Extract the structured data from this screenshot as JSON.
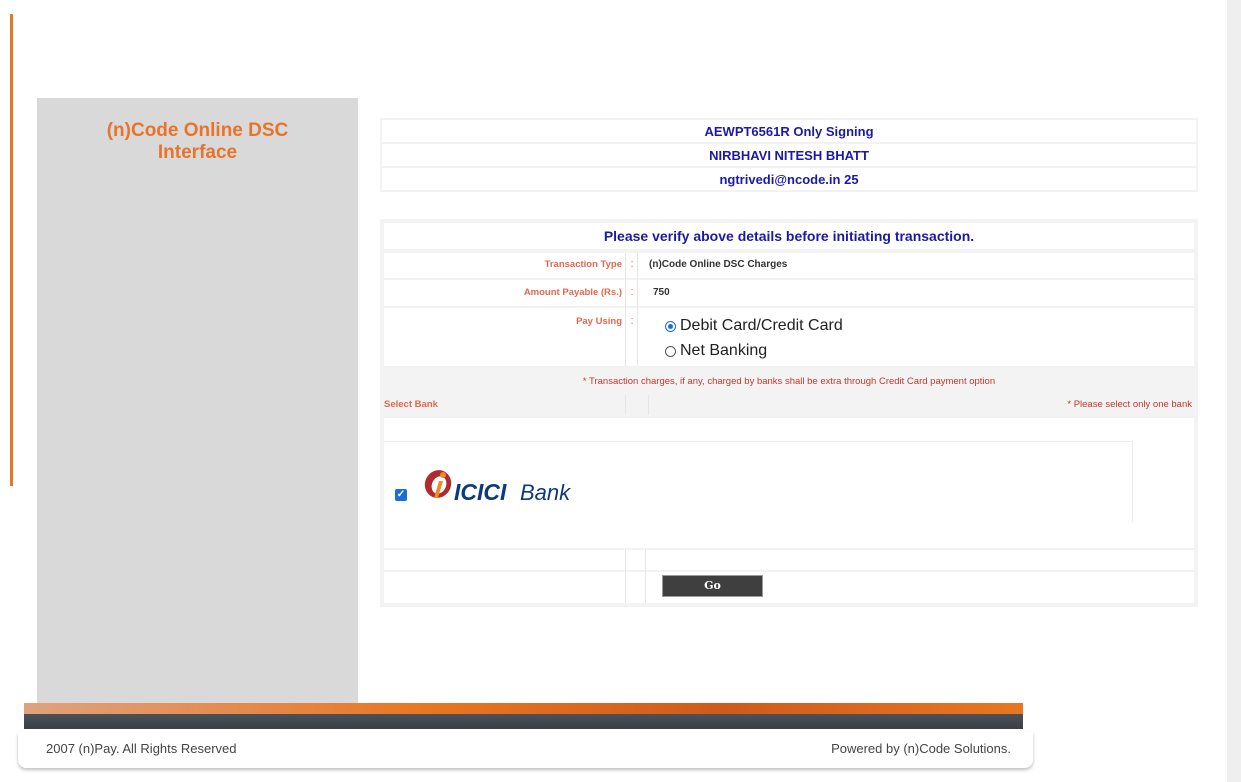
{
  "sidebar": {
    "title_line1": "(n)Code Online DSC",
    "title_line2": "Interface"
  },
  "info": {
    "line1": "AEWPT6561R  Only Signing",
    "line2": "NIRBHAVI NITESH BHATT",
    "line3": "ngtrivedi@ncode.in 25"
  },
  "verify": {
    "title": "Please verify above details before initiating transaction.",
    "transaction_type_label": "Transaction Type",
    "transaction_type_value": "(n)Code Online DSC Charges",
    "amount_label": "Amount Payable (Rs.)",
    "amount_value": "750",
    "pay_using_label": "Pay Using",
    "colon": ":",
    "options": [
      {
        "label": "Debit Card/Credit Card",
        "selected": true
      },
      {
        "label": "Net Banking",
        "selected": false
      }
    ],
    "charges_note": "* Transaction charges, if any, charged by banks shall be extra through Credit Card payment option",
    "select_bank_label": "Select Bank",
    "select_one_note": "* Please select only one bank",
    "bank_name": "ICICI Bank",
    "bank_checked": true,
    "go_label": "Go"
  },
  "footer": {
    "copyright": "2007 (n)Pay. All Rights Reserved",
    "powered_by": "Powered by (n)Code Solutions."
  },
  "colors": {
    "accent_orange": "#e87722",
    "title_blue": "#1a1aa6",
    "label_red": "#e2684e",
    "icici_red": "#b02a30",
    "icici_orange": "#f08a24",
    "icici_navy": "#0b3a7e"
  },
  "icons": {
    "checkbox": "checkbox-checked-icon",
    "radio_on": "radio-selected-icon",
    "radio_off": "radio-unselected-icon",
    "bank_logo": "icici-logo-icon"
  }
}
